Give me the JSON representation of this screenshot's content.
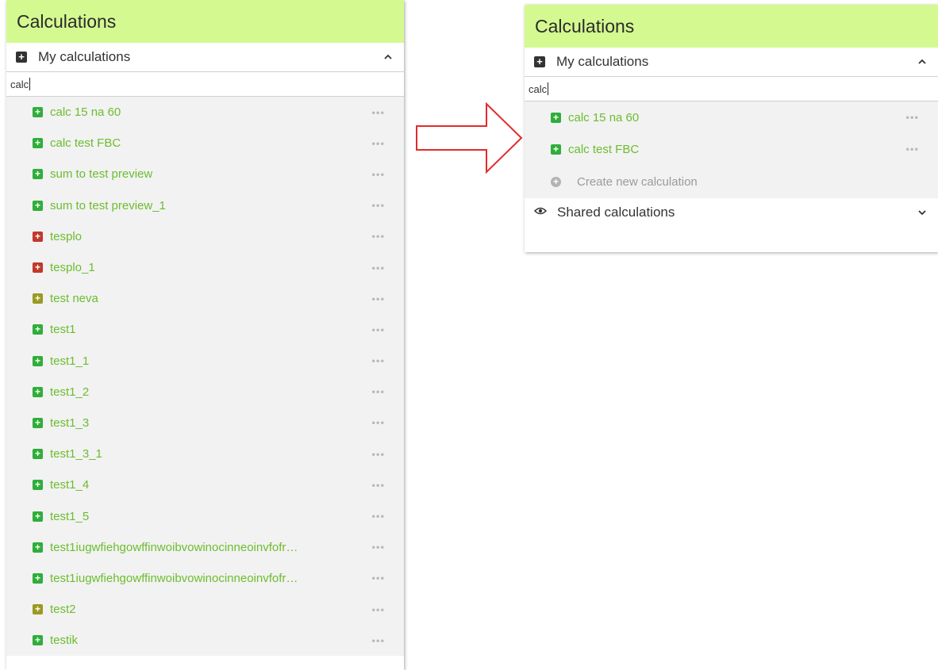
{
  "left_panel": {
    "title": "Calculations",
    "my_calculations": {
      "label": "My calculations",
      "icon": "plus-square-icon",
      "expanded_icon": "chevron-up-icon"
    },
    "search": {
      "value": "calc"
    },
    "items": [
      {
        "label": "calc 15 na 60",
        "icon_color": "#2fae3a",
        "more": "•••"
      },
      {
        "label": "calc test FBC",
        "icon_color": "#2fae3a",
        "more": "•••"
      },
      {
        "label": "sum to test preview",
        "icon_color": "#2fae3a",
        "more": "•••"
      },
      {
        "label": "sum to test preview_1",
        "icon_color": "#2fae3a",
        "more": "•••"
      },
      {
        "label": "tesplo",
        "icon_color": "#c0392b",
        "more": "•••"
      },
      {
        "label": "tesplo_1",
        "icon_color": "#c0392b",
        "more": "•••"
      },
      {
        "label": "test neva",
        "icon_color": "#9a9a22",
        "more": "•••"
      },
      {
        "label": "test1",
        "icon_color": "#2fae3a",
        "more": "•••"
      },
      {
        "label": "test1_1",
        "icon_color": "#2fae3a",
        "more": "•••"
      },
      {
        "label": "test1_2",
        "icon_color": "#2fae3a",
        "more": "•••"
      },
      {
        "label": "test1_3",
        "icon_color": "#2fae3a",
        "more": "•••"
      },
      {
        "label": "test1_3_1",
        "icon_color": "#2fae3a",
        "more": "•••"
      },
      {
        "label": "test1_4",
        "icon_color": "#2fae3a",
        "more": "•••"
      },
      {
        "label": "test1_5",
        "icon_color": "#2fae3a",
        "more": "•••"
      },
      {
        "label": "test1iugwfiehgowffinwoibvowinocinneoinvfofr…",
        "icon_color": "#2fae3a",
        "more": "•••"
      },
      {
        "label": "test1iugwfiehgowffinwoibvowinocinneoinvfofr…",
        "icon_color": "#2fae3a",
        "more": "•••"
      },
      {
        "label": "test2",
        "icon_color": "#9a9a22",
        "more": "•••"
      },
      {
        "label": "testik",
        "icon_color": "#2fae3a",
        "more": "•••"
      }
    ]
  },
  "right_panel": {
    "title": "Calculations",
    "my_calculations": {
      "label": "My calculations",
      "icon": "plus-square-icon",
      "expanded_icon": "chevron-up-icon"
    },
    "search": {
      "value": "calc"
    },
    "items": [
      {
        "label": "calc 15 na 60",
        "icon_color": "#2fae3a",
        "more": "•••"
      },
      {
        "label": "calc test FBC",
        "icon_color": "#2fae3a",
        "more": "•••"
      }
    ],
    "create_new": {
      "label": "Create new calculation",
      "icon": "plus-circle-icon"
    },
    "shared_calculations": {
      "label": "Shared calculations",
      "icon": "eye-icon",
      "collapsed_icon": "chevron-down-icon"
    }
  },
  "arrow": {
    "icon": "right-arrow-outline",
    "color": "#e32b2b"
  },
  "colors": {
    "header_bg": "#d4f990",
    "item_text": "#6cbd2e",
    "list_bg": "#f2f2f2"
  }
}
